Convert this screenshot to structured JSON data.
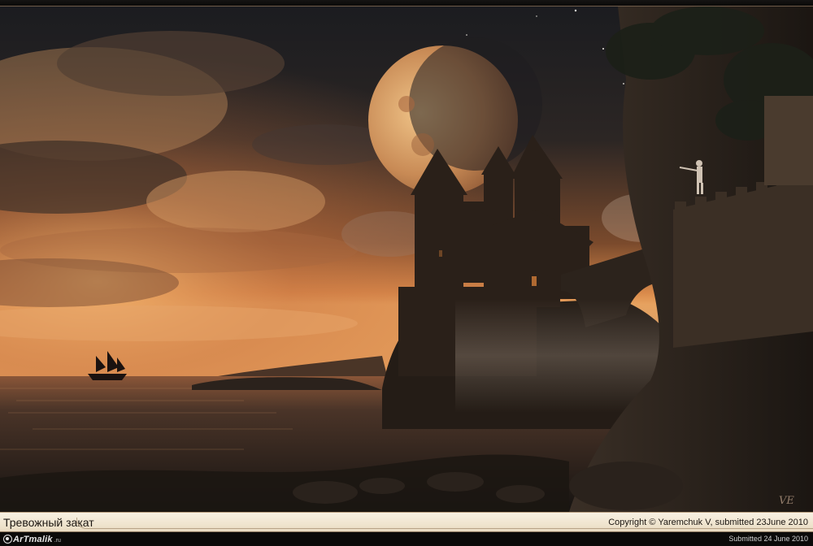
{
  "artwork": {
    "subject": "castle-at-sunset-scene",
    "colors": {
      "sky_glow": "#d98a4b",
      "sky_dark": "#1c1c1f",
      "moon": "#d7a26a",
      "sea": "#4a3428",
      "castle": "#2a2019"
    },
    "signature": "VE"
  },
  "caption": {
    "title": "Тревожный закат",
    "copyright": "Copyright © Yaremchuk V, submitted 23June 2010"
  },
  "footer": {
    "logo": {
      "text": "ArTmalik",
      "suffix": ".ru"
    },
    "submitted": "Submitted 24 June 2010"
  }
}
